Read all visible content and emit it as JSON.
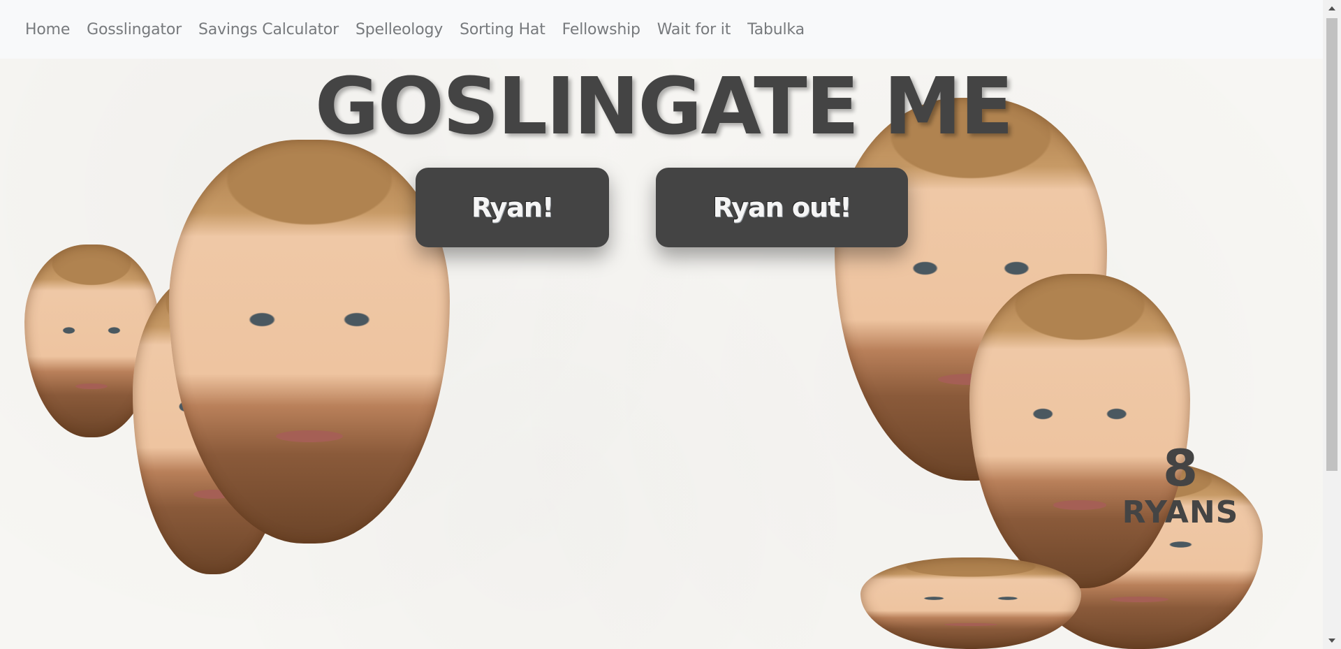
{
  "nav": {
    "items": [
      {
        "label": "Home"
      },
      {
        "label": "Gosslingator"
      },
      {
        "label": "Savings Calculator"
      },
      {
        "label": "Spelleology"
      },
      {
        "label": "Sorting Hat"
      },
      {
        "label": "Fellowship"
      },
      {
        "label": "Wait for it"
      },
      {
        "label": "Tabulka"
      }
    ]
  },
  "main": {
    "title": "GOSLINGATE ME",
    "buttons": {
      "add_label": "Ryan!",
      "remove_label": "Ryan out!"
    },
    "counter": {
      "count": "8",
      "label": "RYANS"
    }
  },
  "colors": {
    "accent": "#444444",
    "nav_text": "#777a7d",
    "nav_bg": "#f8f9fa",
    "page_bg": "#f7f6f3"
  }
}
